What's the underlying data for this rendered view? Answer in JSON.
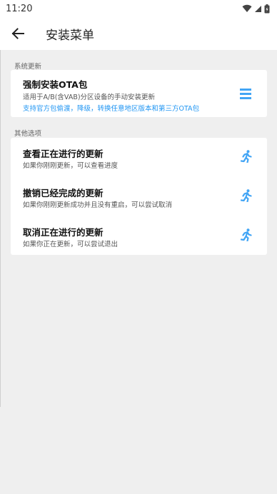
{
  "status": {
    "time": "11:20"
  },
  "appbar": {
    "title": "安装菜单"
  },
  "sections": {
    "system_update": {
      "label": "系统更新",
      "item": {
        "title": "强制安装OTA包",
        "subtitle": "适用于A/B(含VAB)分区设备的手动安装更新",
        "note": "支持官方包偷渡，降级，转换任意地区版本和第三方OTA包"
      }
    },
    "other_options": {
      "label": "其他选项",
      "items": [
        {
          "title": "查看正在进行的更新",
          "subtitle": "如果你刚刚更新，可以查看进度"
        },
        {
          "title": "撤销已经完成的更新",
          "subtitle": "如果你刚刚更新成功并且没有重启，可以尝试取消"
        },
        {
          "title": "取消正在进行的更新",
          "subtitle": "如果你正在更新，可以尝试退出"
        }
      ]
    }
  },
  "colors": {
    "accent": "#2196f3",
    "background": "#efefef",
    "card": "#ffffff"
  },
  "icons": {
    "back": "arrow-left-icon",
    "menu": "list-menu-icon",
    "run": "running-person-icon"
  }
}
